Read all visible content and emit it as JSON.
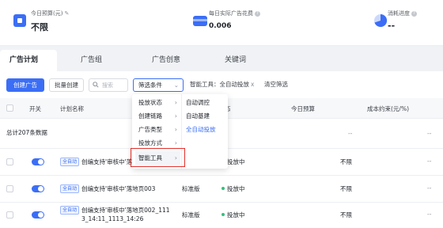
{
  "summary": {
    "budget_label": "今日预算(元)",
    "budget_value": "不限",
    "spend_label": "每日实际广告花费",
    "spend_value": "0.006",
    "progress_label": "消耗进度",
    "progress_value": "--",
    "colors": {
      "budget_icon": "#3b6ef6",
      "spend_icon": "#3b6ef6",
      "progress_icon": "#3b6ef6"
    }
  },
  "tabs": [
    "广告计划",
    "广告组",
    "广告创意",
    "关键词"
  ],
  "toolbar": {
    "create_label": "创建广告",
    "batch_label": "批量创建",
    "search_placeholder": "搜索",
    "filter_label": "筛选条件",
    "chip_label": "智能工具：全自动投放",
    "chip_close": "x",
    "clear_label": "清空筛选"
  },
  "table": {
    "headers": {
      "toggle": "开关",
      "name": "计划名称",
      "status": "态",
      "budget": "今日预算",
      "cost": "成本约束(元/%)"
    },
    "total_label": "总计207条数据",
    "total_budget": "--",
    "total_cost": "--",
    "rows": [
      {
        "tag": "全自动",
        "name": "创编支持'审核中'落地",
        "type": "",
        "status": "投放中",
        "budget": "不限",
        "cost": "--"
      },
      {
        "tag": "全自动",
        "name": "创编支持'审核中'落地页003",
        "type": "标准版",
        "status": "投放中",
        "budget": "不限",
        "cost": "--"
      },
      {
        "tag": "全自动",
        "name_line1": "创编支持'审核中'落地页002_111",
        "name_line2": "3_14:11_1113_14:26",
        "type": "标准版",
        "status": "投放中",
        "budget": "不限",
        "cost": "--"
      }
    ]
  },
  "filter_menu": {
    "items": [
      "投放状态",
      "创建链路",
      "广告类型",
      "投放方式",
      "智能工具"
    ],
    "sub_items": [
      "自动调控",
      "自动基建",
      "全自动投放"
    ],
    "selected_sub": "全自动投放",
    "highlight_color": "#e0312c"
  }
}
